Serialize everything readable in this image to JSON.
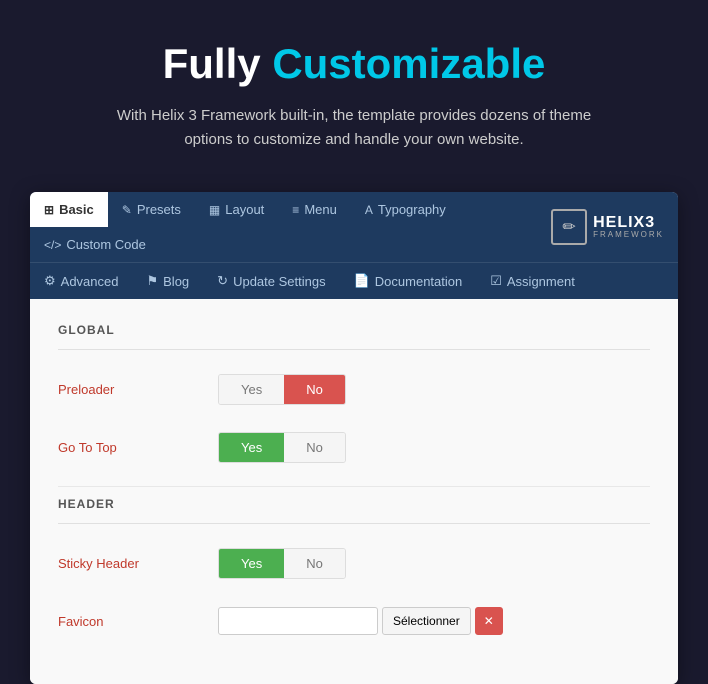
{
  "hero": {
    "title_plain": "Fully",
    "title_accent": "Customizable",
    "subtitle": "With Helix 3 Framework built-in, the template provides dozens of theme options to customize and handle your own website."
  },
  "nav": {
    "top_tabs": [
      {
        "label": "Basic",
        "icon": "⊞",
        "active": true
      },
      {
        "label": "Presets",
        "icon": "✎"
      },
      {
        "label": "Layout",
        "icon": "▦"
      },
      {
        "label": "Menu",
        "icon": "≡"
      },
      {
        "label": "Typography",
        "icon": "A"
      },
      {
        "label": "Custom Code",
        "icon": "</>"
      }
    ],
    "bottom_tabs": [
      {
        "label": "Advanced",
        "icon": "⚙"
      },
      {
        "label": "Blog",
        "icon": "⚑"
      },
      {
        "label": "Update Settings",
        "icon": "↻"
      },
      {
        "label": "Documentation",
        "icon": "📄"
      },
      {
        "label": "Assignment",
        "icon": "☑"
      }
    ],
    "logo_icon": "✏",
    "logo_name": "HELIX3",
    "logo_sub": "FRAMEWORK"
  },
  "sections": [
    {
      "id": "global",
      "label": "GLOBAL",
      "fields": [
        {
          "label": "Preloader",
          "yes_active": false,
          "no_active": true
        },
        {
          "label": "Go To Top",
          "yes_active": true,
          "no_active": false
        }
      ]
    },
    {
      "id": "header",
      "label": "HEADER",
      "fields": [
        {
          "label": "Sticky Header",
          "yes_active": true,
          "no_active": false
        },
        {
          "label": "Favicon",
          "has_file": true
        }
      ]
    }
  ]
}
